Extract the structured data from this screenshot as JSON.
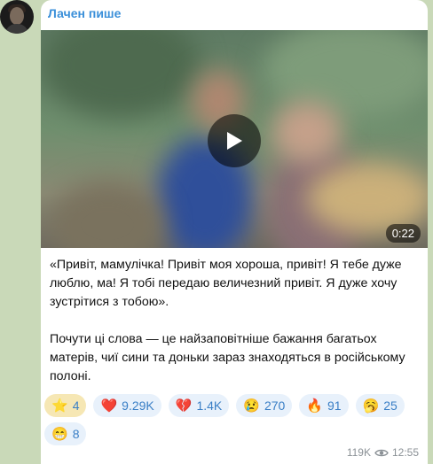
{
  "channel": {
    "name": "Лачен пише"
  },
  "video": {
    "duration": "0:22",
    "play_icon": "play-icon"
  },
  "message": {
    "paragraphs": [
      "«Привіт, мамулічка! Привіт моя хороша, привіт! Я тебе дуже люблю, ма! Я тобі передаю величезний привіт. Я дуже хочу зустрітися з тобою».",
      "Почути ці слова — це найзаповітніше бажання багатьох матерів, чиї сини та доньки зараз знаходяться в російському полоні."
    ]
  },
  "reactions": [
    {
      "emoji": "⭐",
      "count": "4",
      "icon": "star-icon",
      "selected": true
    },
    {
      "emoji": "❤️",
      "count": "9.29K",
      "icon": "heart-icon"
    },
    {
      "emoji": "💔",
      "count": "1.4K",
      "icon": "broken-heart-icon"
    },
    {
      "emoji": "😢",
      "count": "270",
      "icon": "crying-face-icon"
    },
    {
      "emoji": "🔥",
      "count": "91",
      "icon": "fire-icon"
    },
    {
      "emoji": "🥱",
      "count": "25",
      "icon": "yawning-face-icon"
    },
    {
      "emoji": "😁",
      "count": "8",
      "icon": "grinning-face-icon"
    }
  ],
  "meta": {
    "views": "119K",
    "time": "12:55",
    "eye_icon": "eye-icon"
  },
  "colors": {
    "accent": "#3a8fd9",
    "chat_bg": "#c9d9b8",
    "reaction_bg": "#e8f1fb",
    "paid_reaction_bg": "#f6e7b4"
  }
}
